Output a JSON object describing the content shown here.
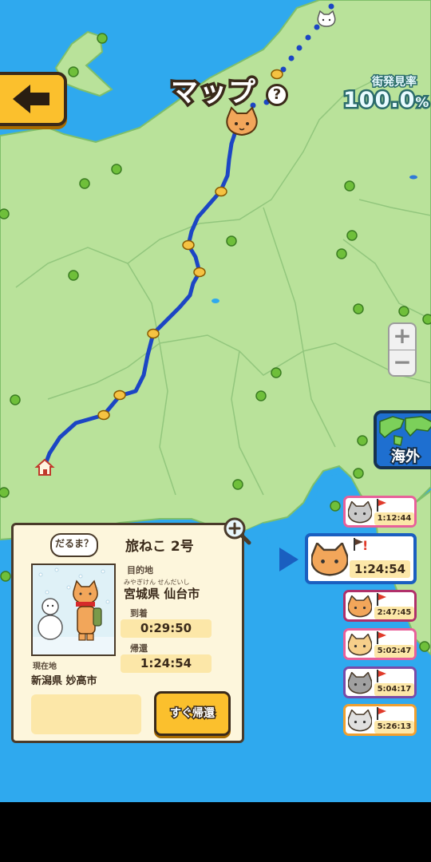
{
  "header": {
    "title": "マップ",
    "help_symbol": "?",
    "discovery_label": "街発見率",
    "discovery_value": "100.0",
    "discovery_unit": "%"
  },
  "zoom": {
    "plus": "+",
    "minus": "−"
  },
  "overseas": {
    "label": "海外"
  },
  "traveler_panel": {
    "bubble": "だるま？",
    "cat_name": "旅ねこ 2号",
    "destination_label": "目的地",
    "destination_ruby": "みやぎけん せんだいし",
    "destination": "宮城県 仙台市",
    "arrival_label": "到着",
    "arrival_time": "0:29:50",
    "return_label": "帰還",
    "return_time": "1:24:54",
    "current_label": "現在地",
    "current_location": "新潟県 妙高市",
    "instant_return_button": "すぐ帰還"
  },
  "cats": [
    {
      "time": "1:12:44",
      "border": "#e8609a",
      "fur": "#c9c9c9",
      "selected": false
    },
    {
      "time": "1:24:54",
      "border": "#1a5fc0",
      "fur": "#f2a65a",
      "selected": true
    },
    {
      "time": "2:47:45",
      "border": "#b0306a",
      "fur": "#f2a65a",
      "selected": false
    },
    {
      "time": "5:02:47",
      "border": "#e8609a",
      "fur": "#f6cf8a",
      "selected": false
    },
    {
      "time": "5:04:17",
      "border": "#7a4aa8",
      "fur": "#a0a0a0",
      "selected": false
    },
    {
      "time": "5:26:13",
      "border": "#f0a030",
      "fur": "#e0e0e0",
      "selected": false
    }
  ],
  "colors": {
    "sea": "#2fa9ee",
    "land": "#b9e29a",
    "route": "#1c46c4",
    "accent": "#fbc02d"
  }
}
